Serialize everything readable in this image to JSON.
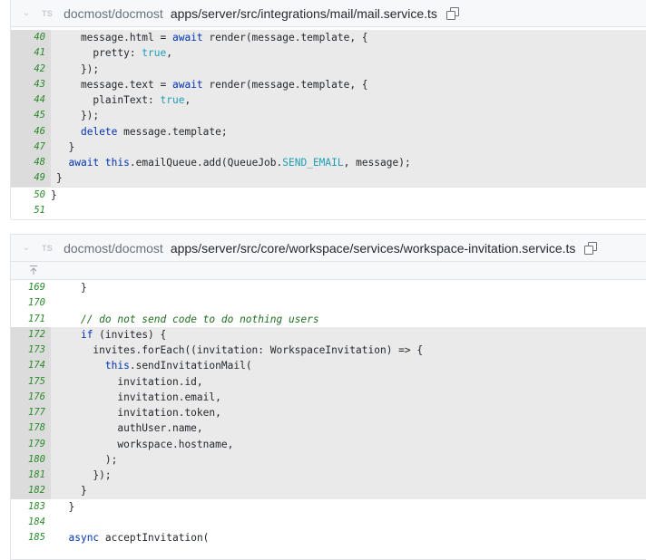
{
  "blocks": [
    {
      "repo": "docmost/docmost",
      "path": "apps/server/src/integrations/mail/mail.service.ts",
      "lang": "TS",
      "lines": [
        {
          "n": "40",
          "indent": "    ",
          "text": "message.html = await render(message.template, {"
        },
        {
          "n": "41",
          "indent": "      ",
          "text": "pretty: true,"
        },
        {
          "n": "42",
          "indent": "    ",
          "text": "});"
        },
        {
          "n": "43",
          "indent": "    ",
          "text": "message.text = await render(message.template, {"
        },
        {
          "n": "44",
          "indent": "      ",
          "text": "plainText: true,"
        },
        {
          "n": "45",
          "indent": "    ",
          "text": "});"
        },
        {
          "n": "46",
          "indent": "    ",
          "text": "delete message.template;"
        },
        {
          "n": "47",
          "indent": "  ",
          "text": "}"
        },
        {
          "n": "48",
          "indent": "  ",
          "text": "await this.emailQueue.add(QueueJob.SEND_EMAIL, message);"
        },
        {
          "n": "49",
          "indent": "",
          "text": "}"
        },
        {
          "n": "50",
          "indent": "",
          "text": "}"
        },
        {
          "n": "51",
          "indent": "",
          "text": ""
        }
      ]
    },
    {
      "repo": "docmost/docmost",
      "path": "apps/server/src/core/workspace/services/workspace-invitation.service.ts",
      "lang": "TS",
      "lines": [
        {
          "n": "169",
          "text": "}"
        },
        {
          "n": "170",
          "text": ""
        },
        {
          "n": "171",
          "text": "// do not send code to do nothing users"
        },
        {
          "n": "172",
          "text": "if (invites) {"
        },
        {
          "n": "173",
          "text": "invites.forEach((invitation: WorkspaceInvitation) => {"
        },
        {
          "n": "174",
          "text": "this.sendInvitationMail("
        },
        {
          "n": "175",
          "text": "invitation.id,"
        },
        {
          "n": "176",
          "text": "invitation.email,"
        },
        {
          "n": "177",
          "text": "invitation.token,"
        },
        {
          "n": "178",
          "text": "authUser.name,"
        },
        {
          "n": "179",
          "text": "workspace.hostname,"
        },
        {
          "n": "180",
          "text": ");"
        },
        {
          "n": "181",
          "text": "});"
        },
        {
          "n": "182",
          "text": "}"
        },
        {
          "n": "183",
          "text": "}"
        },
        {
          "n": "184",
          "text": ""
        },
        {
          "n": "185",
          "text": "async acceptInvitation("
        }
      ]
    }
  ],
  "icons": {
    "collapse": "chevron-down-icon",
    "copy": "copy-icon",
    "expand": "expand-up-icon"
  }
}
